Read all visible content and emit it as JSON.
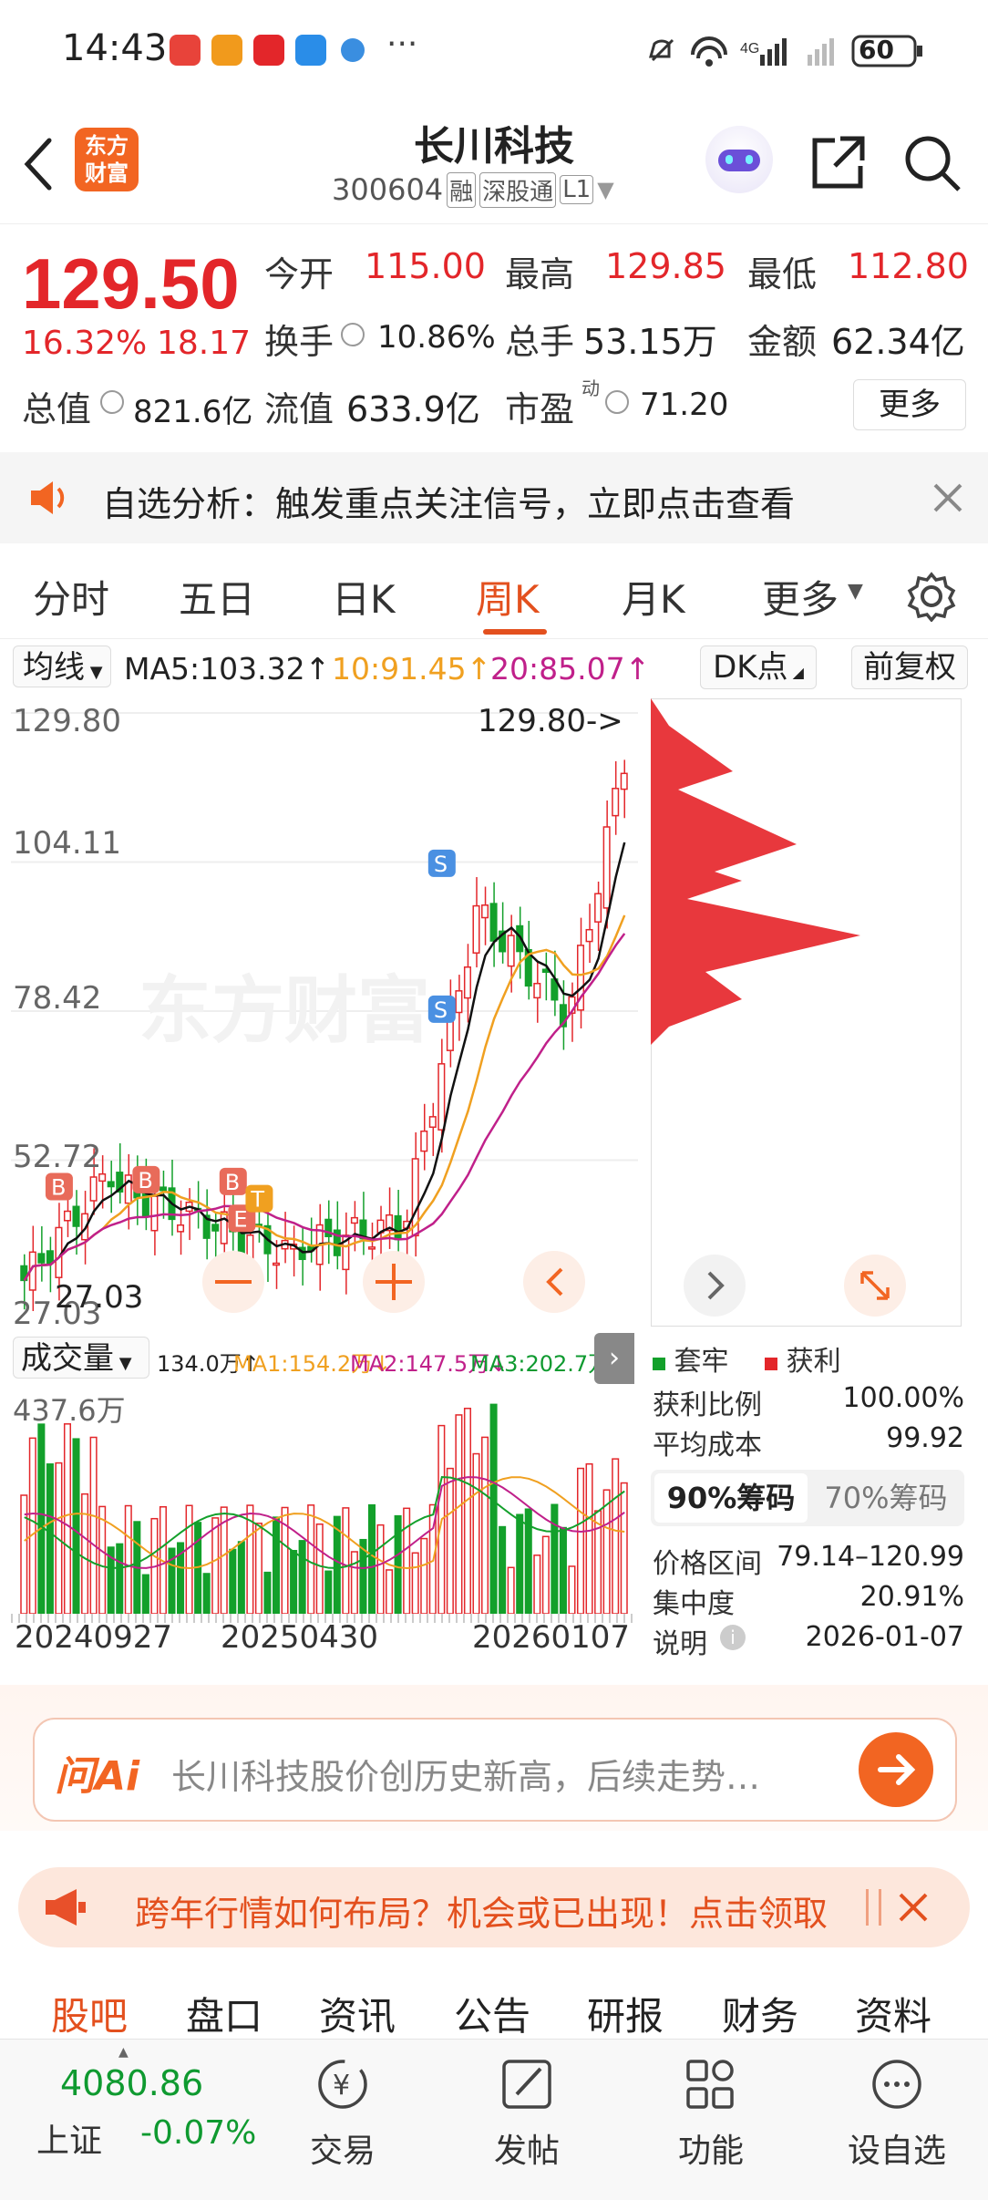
{
  "status_bar": {
    "time": "14:43",
    "battery": "60"
  },
  "header": {
    "logo_text_line1": "东方",
    "logo_text_line2": "财富",
    "stock_name": "长川科技",
    "stock_code": "300604",
    "badge_margin": "融",
    "badge_connect": "深股通",
    "badge_level": "L1"
  },
  "quote": {
    "price": "129.50",
    "change_pct": "16.32%",
    "change_amt": "18.17",
    "open_label": "今开",
    "open_value": "115.00",
    "high_label": "最高",
    "high_value": "129.85",
    "low_label": "最低",
    "low_value": "112.80",
    "turnover_label": "换手",
    "turnover_value": "10.86%",
    "volume_label": "总手",
    "volume_value": "53.15万",
    "amount_label": "金额",
    "amount_value": "62.34亿",
    "total_mv_label": "总值",
    "total_mv_value": "821.6亿",
    "float_mv_label": "流值",
    "float_mv_value": "633.9亿",
    "pe_label": "市盈",
    "pe_sup": "动",
    "pe_value": "71.20",
    "more_label": "更多"
  },
  "banner": {
    "text": "自选分析：触发重点关注信号，立即点击查看"
  },
  "tabs": [
    {
      "label": "分时"
    },
    {
      "label": "五日"
    },
    {
      "label": "日K"
    },
    {
      "label": "周K"
    },
    {
      "label": "月K"
    },
    {
      "label": "更多"
    }
  ],
  "toolbar": {
    "indicator": "均线",
    "ma5": "MA5:103.32↑",
    "ma10": "10:91.45↑",
    "ma20": "20:85.07↑",
    "dk": "DK点",
    "adjust": "前复权"
  },
  "chart": {
    "y_labels": [
      "129.80",
      "104.11",
      "78.42",
      "52.72",
      "27.03"
    ],
    "max_marker": "129.80->",
    "min_marker": "27.03",
    "watermark": "东方财富",
    "ma_colors": {
      "ma5": "#111111",
      "ma10": "#f0a020",
      "ma20": "#c0208a"
    },
    "up_color": "#e3262a",
    "down_color": "#13a02b"
  },
  "volume": {
    "selector": "成交量",
    "vol": "134.0万↑",
    "ma1": "MA1:154.2万↓",
    "ma2": "MA2:147.5万↓",
    "ma3": "MA3:202.7万↓",
    "max_label": "437.6万",
    "dates": [
      "20240927",
      "20250430",
      "20260107"
    ]
  },
  "chip_panel": {
    "legend_trapped": "套牢",
    "legend_profit": "获利",
    "profit_ratio_label": "获利比例",
    "profit_ratio_value": "100.00%",
    "avg_cost_label": "平均成本",
    "avg_cost_value": "99.92",
    "tab_90": "90%筹码",
    "tab_70": "70%筹码",
    "range_label": "价格区间",
    "range_value": "79.14–120.99",
    "concentration_label": "集中度",
    "concentration_value": "20.91%",
    "note_label": "说明",
    "note_value": "2026-01-07"
  },
  "ai": {
    "logo": "问Ai",
    "placeholder": "长川科技股价创历史新高，后续走势…"
  },
  "promo": {
    "text": "跨年行情如何布局？机会或已出现！点击领取"
  },
  "subtabs": [
    {
      "label": "股吧"
    },
    {
      "label": "盘口"
    },
    {
      "label": "资讯"
    },
    {
      "label": "公告"
    },
    {
      "label": "研报"
    },
    {
      "label": "财务"
    },
    {
      "label": "资料"
    }
  ],
  "bottom_nav": {
    "index_value": "4080.86",
    "index_name": "上证",
    "index_change": "-0.07%",
    "trade": "交易",
    "post": "发帖",
    "functions": "功能",
    "add_watch": "设自选"
  }
}
